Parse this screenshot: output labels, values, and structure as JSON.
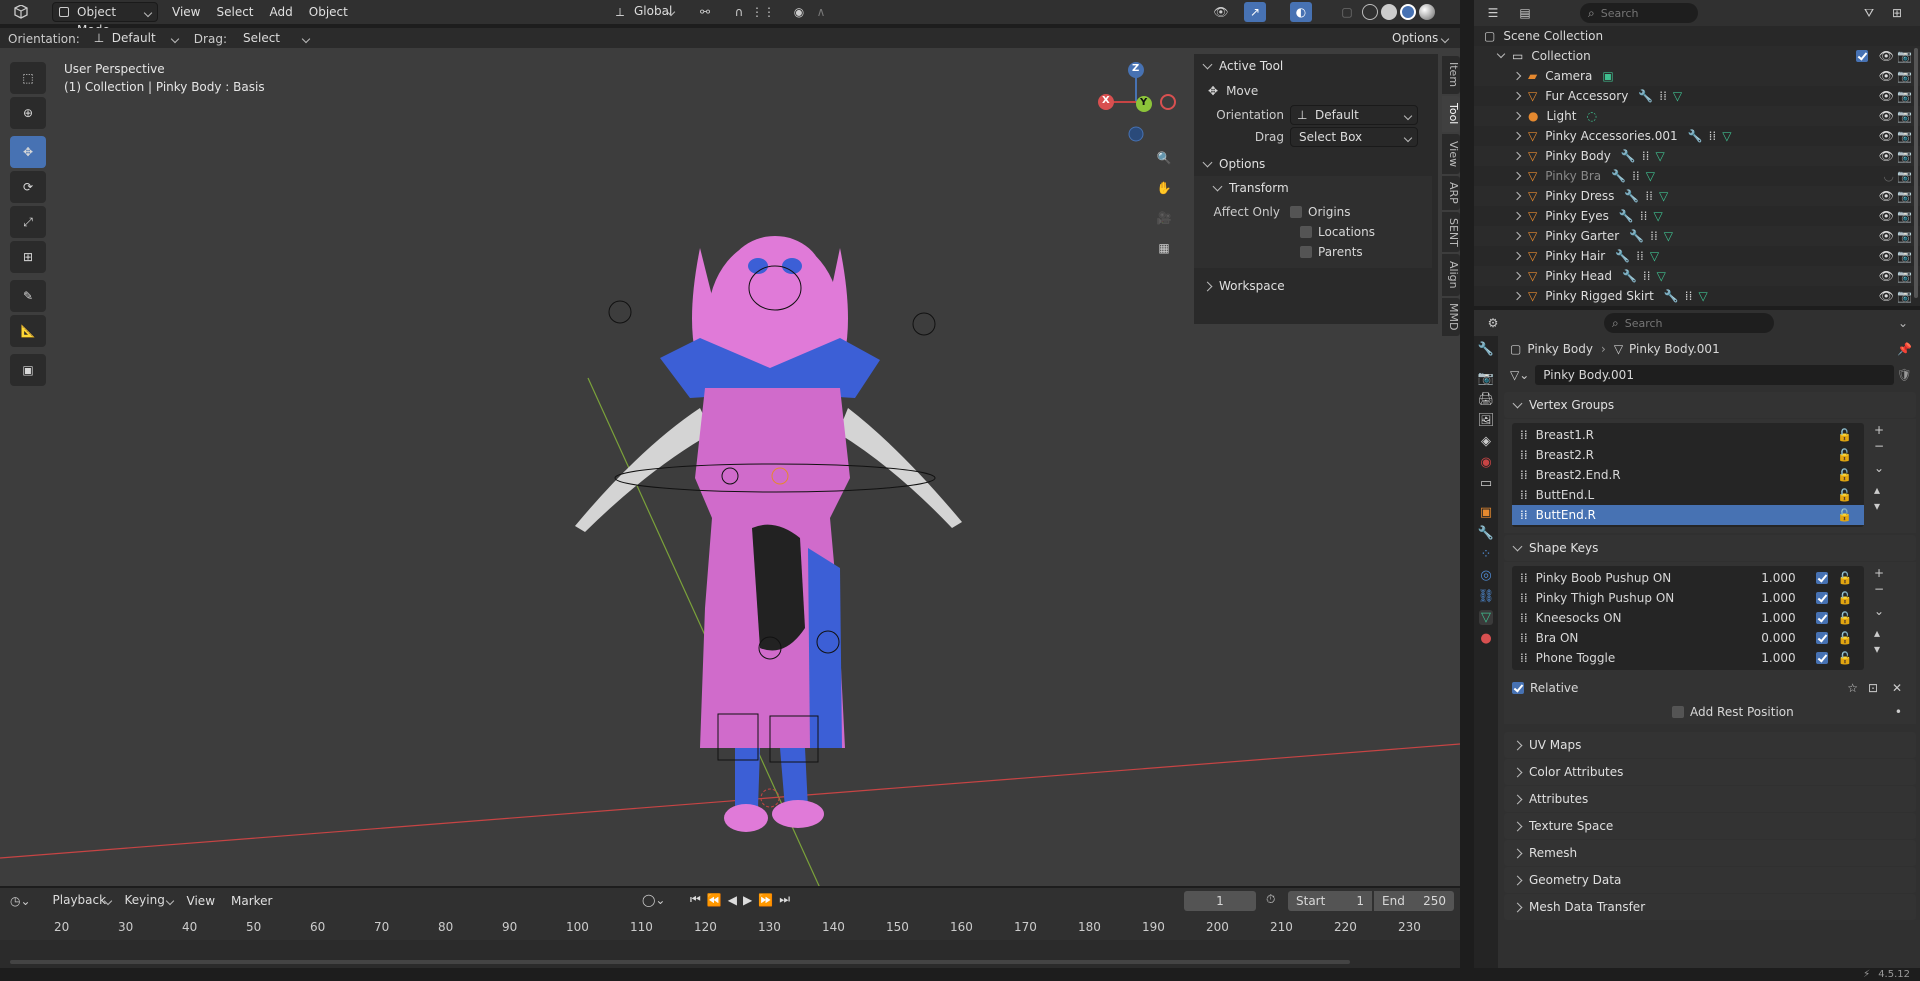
{
  "colors": {
    "accent": "#4772b3",
    "orange": "#e5892f",
    "green": "#3fbf8f",
    "mesh_pink": "#e07ad8",
    "mesh_blue": "#3c5fd6",
    "red_axis": "#c74444",
    "green_axis": "#7ba23a"
  },
  "topbar": {
    "mode": "Object Mode",
    "menus": [
      "View",
      "Select",
      "Add",
      "Object"
    ],
    "transform_space": "Global"
  },
  "tool_header": {
    "orientation_label": "Orientation:",
    "orientation_value": "Default",
    "drag_label": "Drag:",
    "drag_value": "Select Box",
    "options": "Options"
  },
  "viewport": {
    "perspective": "User Perspective",
    "info": "(1) Collection | Pinky Body : Basis",
    "gizmo": {
      "z": "Z",
      "y": "Y",
      "x": "X"
    }
  },
  "npanel": {
    "active_tool_title": "Active Tool",
    "tool_name": "Move",
    "orientation_label": "Orientation",
    "orientation_value": "Default",
    "drag_label": "Drag",
    "drag_value": "Select Box",
    "options_title": "Options",
    "transform_title": "Transform",
    "affect_only": "Affect Only",
    "affect_items": [
      "Origins",
      "Locations",
      "Parents"
    ],
    "workspace_title": "Workspace",
    "tabs": [
      "Item",
      "Tool",
      "View",
      "ARP",
      "SENT",
      "Align",
      "MMD"
    ]
  },
  "outliner": {
    "search_placeholder": "Search",
    "scene_collection": "Scene Collection",
    "collection": "Collection",
    "items": [
      "Camera",
      "Fur Accessory",
      "Light",
      "Pinky Accessories.001",
      "Pinky Body",
      "Pinky Bra",
      "Pinky Dress",
      "Pinky Eyes",
      "Pinky Garter",
      "Pinky Hair",
      "Pinky Head",
      "Pinky Rigged Skirt"
    ]
  },
  "properties": {
    "search_placeholder": "Search",
    "breadcrumb_object": "Pinky Body",
    "breadcrumb_data": "Pinky Body.001",
    "mesh_name": "Pinky Body.001",
    "vertex_groups_title": "Vertex Groups",
    "vertex_groups": [
      "Breast1.R",
      "Breast2.R",
      "Breast2.End.R",
      "ButtEnd.L",
      "ButtEnd.R"
    ],
    "shape_keys_title": "Shape Keys",
    "shape_keys": [
      {
        "name": "Pinky Boob Pushup ON",
        "value": "1.000"
      },
      {
        "name": "Pinky Thigh Pushup ON",
        "value": "1.000"
      },
      {
        "name": "Kneesocks ON",
        "value": "1.000"
      },
      {
        "name": "Bra ON",
        "value": "0.000"
      },
      {
        "name": "Phone Toggle",
        "value": "1.000"
      }
    ],
    "relative": "Relative",
    "add_rest_position": "Add Rest Position",
    "sections": [
      "UV Maps",
      "Color Attributes",
      "Attributes",
      "Texture Space",
      "Remesh",
      "Geometry Data",
      "Mesh Data Transfer"
    ]
  },
  "timeline": {
    "menus": [
      "Playback",
      "Keying",
      "View",
      "Marker"
    ],
    "current_frame": "1",
    "start_label": "Start",
    "start_value": "1",
    "end_label": "End",
    "end_value": "250",
    "ruler": [
      "20",
      "30",
      "40",
      "50",
      "60",
      "70",
      "80",
      "90",
      "100",
      "110",
      "120",
      "130",
      "140",
      "150",
      "160",
      "170",
      "180",
      "190",
      "200",
      "210",
      "220",
      "230"
    ]
  },
  "status": {
    "version": "4.5.12"
  }
}
